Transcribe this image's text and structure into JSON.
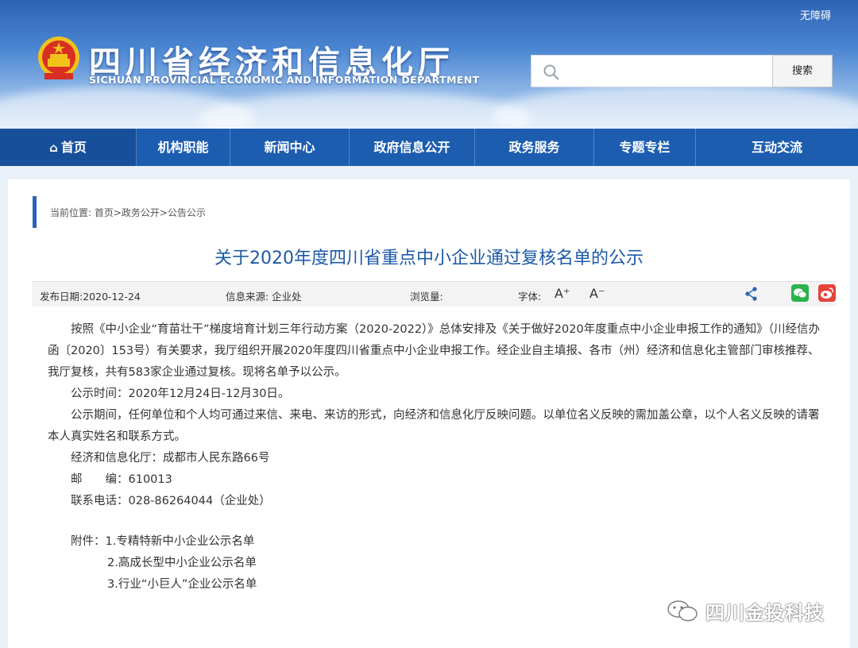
{
  "header": {
    "accessibility": "无障碍",
    "site_title": "四川省经济和信息化厅",
    "site_subtitle": "SICHUAN PROVINCIAL ECONOMIC AND INFORMATION DEPARTMENT",
    "search_placeholder": "",
    "search_button": "搜索"
  },
  "nav": {
    "items": [
      {
        "label": "首页"
      },
      {
        "label": "机构职能"
      },
      {
        "label": "新闻中心"
      },
      {
        "label": "政府信息公开"
      },
      {
        "label": "政务服务"
      },
      {
        "label": "专题专栏"
      },
      {
        "label": "互动交流"
      }
    ],
    "home_icon": "home-icon"
  },
  "breadcrumb": "当前位置: 首页>政务公开>公告公示",
  "article": {
    "title": "关于2020年度四川省重点中小企业通过复核名单的公示",
    "meta": {
      "publish_date": "发布日期:2020-12-24",
      "source": "信息来源:  企业处",
      "views": "浏览量:",
      "font_label": "字体:",
      "font_up": "A⁺",
      "font_down": "A⁻"
    },
    "paragraphs": [
      "按照《中小企业“育苗壮干”梯度培育计划三年行动方案（2020-2022）》总体安排及《关于做好2020年度重点中小企业申报工作的通知》（川经信办函〔2020〕153号）有关要求，我厅组织开展2020年度四川省重点中小企业申报工作。经企业自主填报、各市（州）经济和信息化主管部门审核推荐、我厅复核，共有583家企业通过复核。现将名单予以公示。",
      "公示时间：2020年12月24日-12月30日。",
      "公示期间，任何单位和个人均可通过来信、来电、来访的形式，向经济和信息化厅反映问题。以单位名义反映的需加盖公章，以个人名义反映的请署本人真实姓名和联系方式。"
    ],
    "contacts": [
      "经济和信息化厅：成都市人民东路66号",
      "邮　　编：610013",
      "联系电话：028-86264044（企业处）"
    ],
    "attachments": {
      "label": "附件：",
      "items": [
        "1.专精特新中小企业公示名单",
        "2.高成长型中小企业公示名单",
        "3.行业“小巨人”企业公示名单"
      ]
    }
  },
  "watermark": "四川金投科技",
  "colors": {
    "nav_bg": "#1c5db0",
    "title": "#1d5aa8",
    "accent_bar": "#2a64b4"
  }
}
